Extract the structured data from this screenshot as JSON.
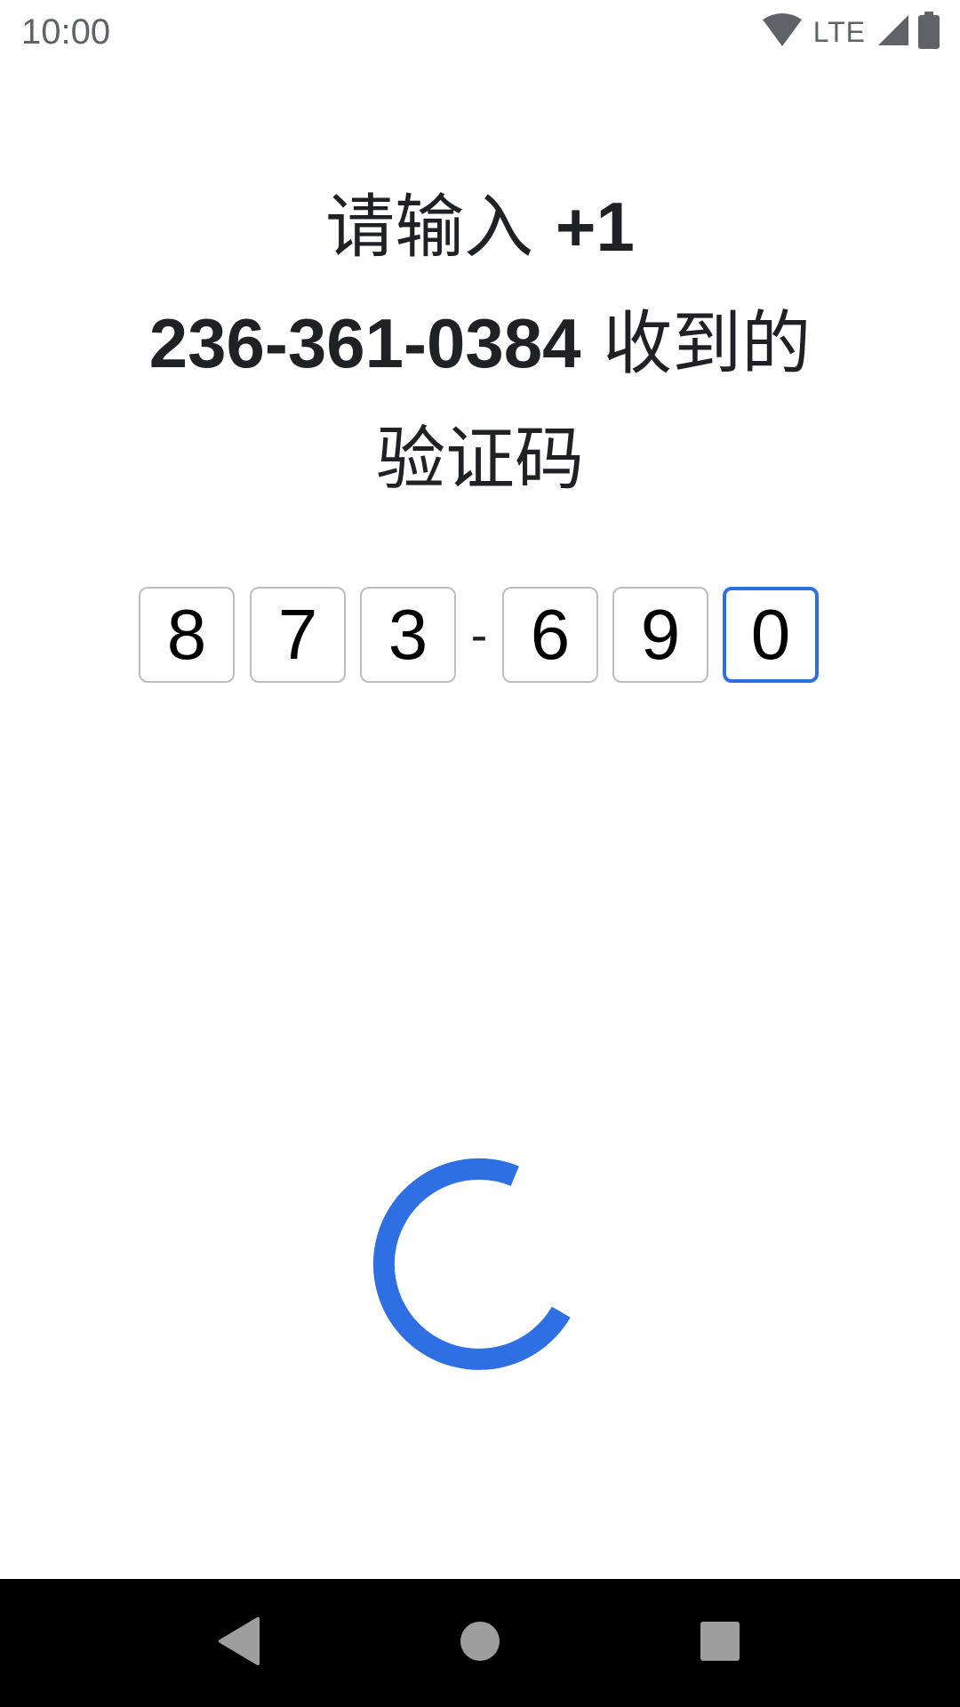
{
  "status_bar": {
    "time": "10:00",
    "network_label": "LTE",
    "icons": [
      "wifi-icon",
      "cellular-signal-icon",
      "battery-icon"
    ]
  },
  "title": {
    "prefix": "请输入 ",
    "phone_part1": "+1",
    "phone_part2": "236-361-0384",
    "middle": " 收到的",
    "suffix": "验证码"
  },
  "code_input": {
    "digits": [
      "8",
      "7",
      "3",
      "6",
      "9",
      "0"
    ],
    "separator": "-",
    "active_index": 5
  },
  "loading": {
    "icon": "loading-spinner-icon"
  },
  "navigation_bar": {
    "buttons": [
      "back-icon",
      "home-icon",
      "recents-icon"
    ]
  },
  "colors": {
    "accent": "#2f6fe4",
    "box_border": "#bdbdbd",
    "status_text": "#5f6368",
    "nav_background": "#000000",
    "nav_icon": "#9e9e9e"
  }
}
